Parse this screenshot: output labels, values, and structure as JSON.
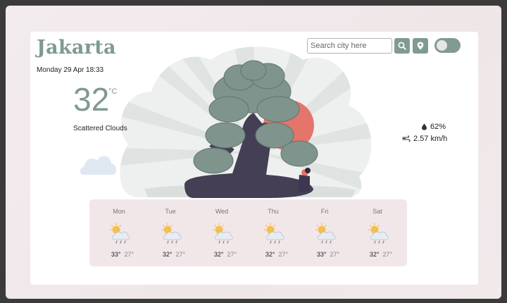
{
  "app": {
    "city": "Jakarta",
    "datetime": "Monday 29 Apr 18:33",
    "temperature": "32",
    "unit": "°C",
    "condition": "Scattered Clouds"
  },
  "search": {
    "placeholder": "Search city here",
    "search_icon": "search-icon",
    "location_icon": "location-pin-icon"
  },
  "toggle": {
    "state": "off"
  },
  "stats": {
    "humidity": "62%",
    "humidity_icon": "humidity-drop-icon",
    "wind": "2.57 km/h",
    "wind_icon": "wind-icon"
  },
  "forecast": [
    {
      "day": "Mon",
      "high": "33°",
      "low": "27°",
      "icon": "sun-cloud-rain-icon"
    },
    {
      "day": "Tue",
      "high": "32°",
      "low": "27°",
      "icon": "sun-cloud-rain-icon"
    },
    {
      "day": "Wed",
      "high": "32°",
      "low": "27°",
      "icon": "sun-cloud-rain-icon"
    },
    {
      "day": "Thu",
      "high": "32°",
      "low": "27°",
      "icon": "sun-cloud-rain-icon"
    },
    {
      "day": "Fri",
      "high": "33°",
      "low": "27°",
      "icon": "sun-cloud-rain-icon"
    },
    {
      "day": "Sat",
      "high": "32°",
      "low": "27°",
      "icon": "sun-cloud-rain-icon"
    }
  ],
  "colors": {
    "accent": "#7f9a8f",
    "forecast_bg": "#f1e6e8",
    "sun": "#e4756b"
  }
}
